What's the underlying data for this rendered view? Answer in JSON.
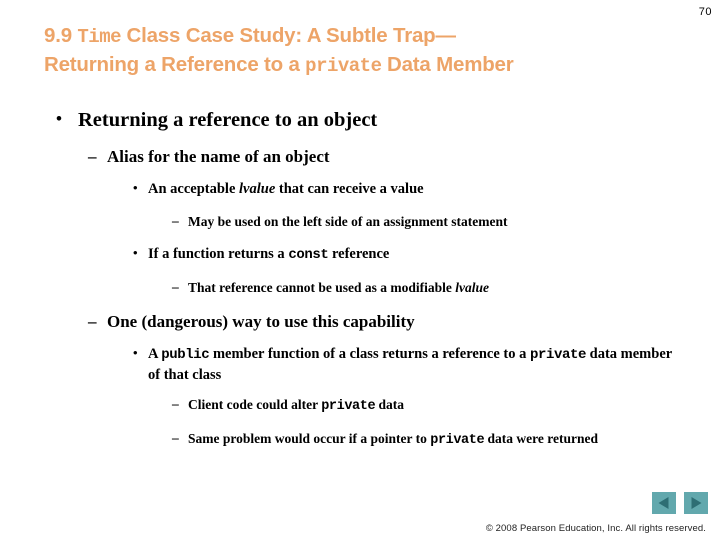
{
  "page": {
    "number": "70",
    "accent_color": "#EDA468",
    "nav_color": "#62A8AD",
    "nav_arrow_color": "#2E6E74",
    "background_color": "#FFFFFF",
    "text_color": "#000000"
  },
  "title": {
    "line1_part1": "9.9 ",
    "line1_mono": "Time",
    "line1_part2": " Class Case Study: A Subtle Trap—",
    "line2_part1": "Returning a Reference to a ",
    "line2_mono": "private",
    "line2_part2": " Data Member",
    "full_text": "9.9 Time Class Case Study: A Subtle Trap—Returning a Reference to a private Data Member"
  },
  "body": {
    "items": [
      {
        "level": 1,
        "marker": "•",
        "text": "Returning a reference to an object"
      },
      {
        "level": 2,
        "marker": "–",
        "text": "Alias for the name of an object"
      },
      {
        "level": 3,
        "marker": "•",
        "pre": "An acceptable ",
        "italic": "lvalue",
        "post": " that can receive a value"
      },
      {
        "level": 4,
        "marker": "–",
        "text": "May be used on the left side of an assignment statement"
      },
      {
        "level": 3,
        "marker": "•",
        "pre": "If a function returns a ",
        "mono": "const",
        "post": " reference"
      },
      {
        "level": 4,
        "marker": "–",
        "pre": "That reference cannot be used as a modifiable ",
        "italic": "lvalue",
        "post": ""
      },
      {
        "level": 2,
        "marker": "–",
        "text": "One (dangerous) way to use this capability"
      },
      {
        "level": 3,
        "marker": "•",
        "pre": "A ",
        "mono": "public",
        "mid": " member function of a class returns a reference to a ",
        "mono2": "private",
        "post": " data member of that class"
      },
      {
        "level": 4,
        "marker": "–",
        "pre": "Client code could alter ",
        "mono": "private",
        "post": " data"
      },
      {
        "level": 4,
        "marker": "–",
        "pre": "Same problem would occur if a pointer to ",
        "mono": "private",
        "post": " data were returned"
      }
    ]
  },
  "nav": {
    "prev_label": "Previous slide",
    "next_label": "Next slide",
    "prev_icon": "triangle-left-icon",
    "next_icon": "triangle-right-icon"
  },
  "footer": {
    "copyright": "© 2008 Pearson Education, Inc.  All rights reserved."
  }
}
